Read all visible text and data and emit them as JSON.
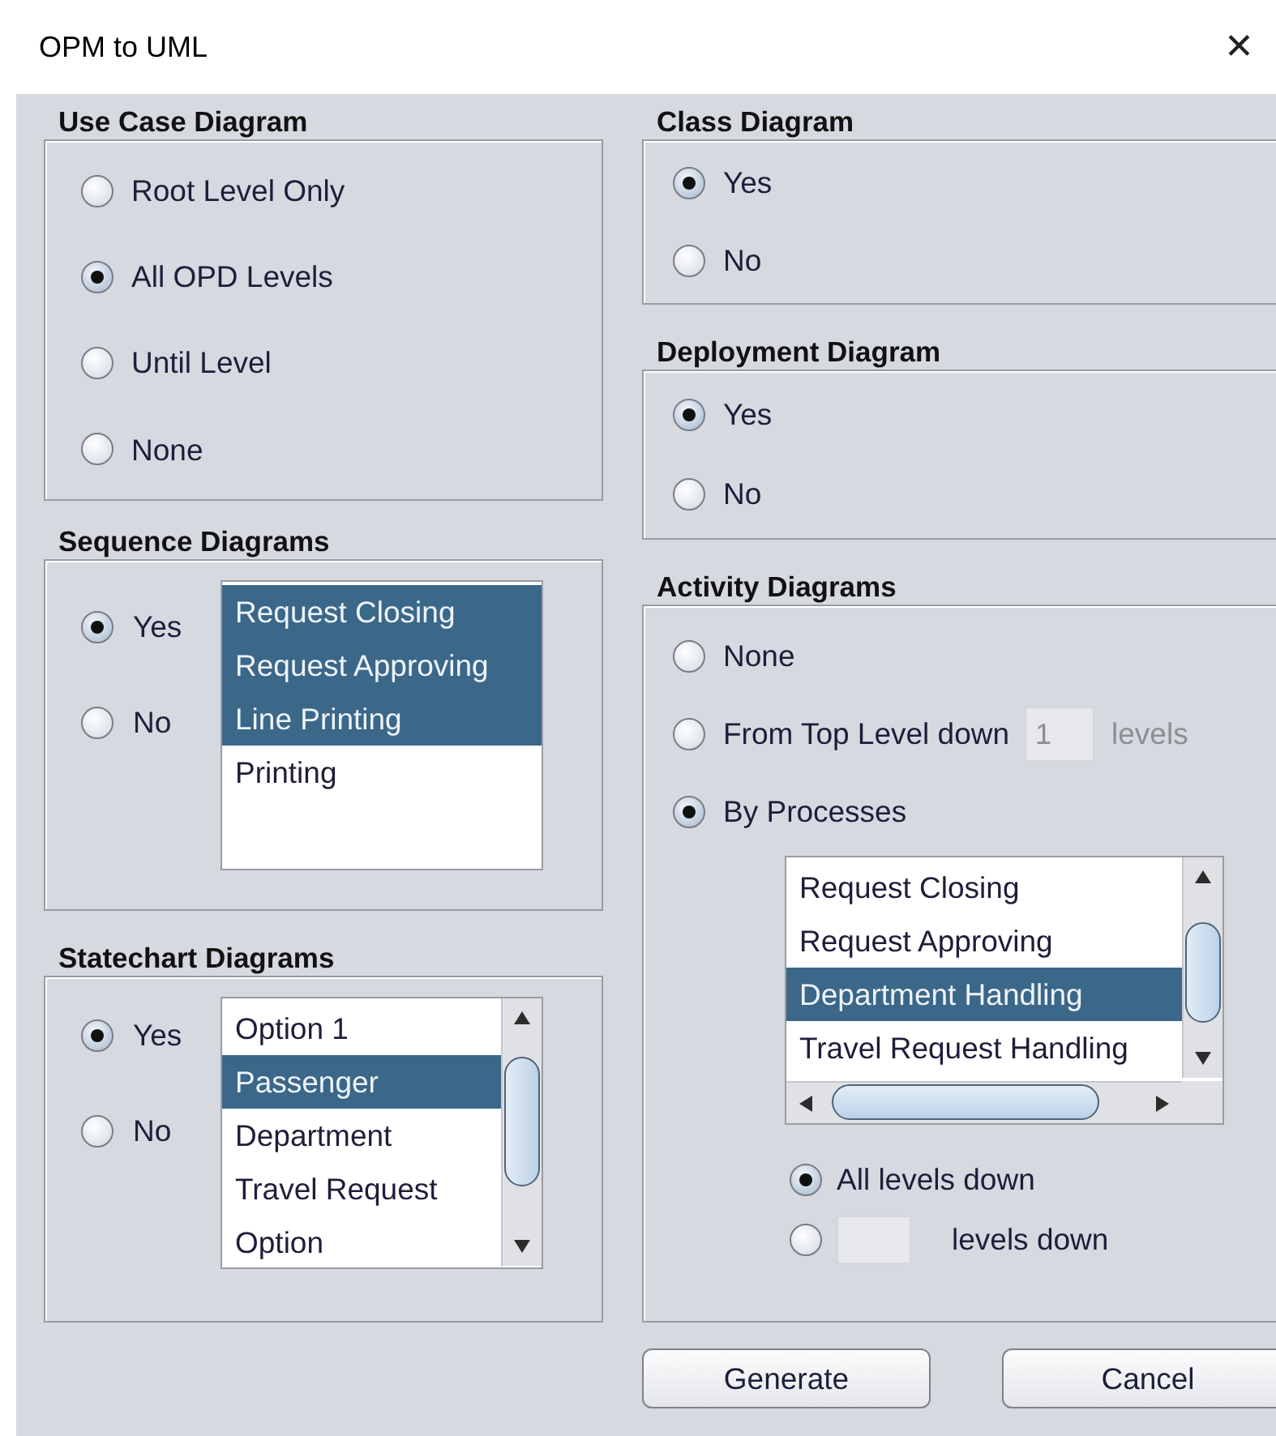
{
  "window": {
    "title": "OPM to UML",
    "close": "✕"
  },
  "use_case": {
    "title": "Use Case Diagram",
    "options": [
      {
        "label": "Root Level Only",
        "selected": false
      },
      {
        "label": "All OPD Levels",
        "selected": true
      },
      {
        "label": "Until Level",
        "selected": false
      },
      {
        "label": "None",
        "selected": false
      }
    ]
  },
  "sequence": {
    "title": "Sequence Diagrams",
    "options": [
      {
        "label": "Yes",
        "selected": true
      },
      {
        "label": "No",
        "selected": false
      }
    ],
    "items": [
      {
        "label": "Request Closing",
        "selected": true
      },
      {
        "label": "Request Approving",
        "selected": true
      },
      {
        "label": "Line Printing",
        "selected": true
      },
      {
        "label": "Printing",
        "selected": false
      }
    ]
  },
  "statechart": {
    "title": "Statechart Diagrams",
    "options": [
      {
        "label": "Yes",
        "selected": true
      },
      {
        "label": "No",
        "selected": false
      }
    ],
    "items": [
      {
        "label": "Option 1",
        "selected": false
      },
      {
        "label": "Passenger",
        "selected": true
      },
      {
        "label": "Department",
        "selected": false
      },
      {
        "label": "Travel Request",
        "selected": false
      },
      {
        "label": "Option",
        "selected": false
      }
    ]
  },
  "class_diagram": {
    "title": "Class Diagram",
    "options": [
      {
        "label": "Yes",
        "selected": true
      },
      {
        "label": "No",
        "selected": false
      }
    ]
  },
  "deployment": {
    "title": "Deployment Diagram",
    "options": [
      {
        "label": "Yes",
        "selected": true
      },
      {
        "label": "No",
        "selected": false
      }
    ]
  },
  "activity": {
    "title": "Activity Diagrams",
    "options": [
      {
        "kind": "plain",
        "label": "None",
        "selected": false
      },
      {
        "kind": "levels",
        "label": "From Top Level down",
        "value": "1",
        "suffix": "levels",
        "disabled": true,
        "selected": false
      },
      {
        "kind": "plain",
        "label": "By Processes",
        "selected": true
      }
    ],
    "items": [
      {
        "label": "Request Closing",
        "selected": false
      },
      {
        "label": "Request Approving",
        "selected": false
      },
      {
        "label": "Department Handling",
        "selected": true
      },
      {
        "label": "Travel Request Handling",
        "selected": false
      }
    ],
    "depth_options": [
      {
        "kind": "plain",
        "label": "All levels down",
        "selected": true
      },
      {
        "kind": "field",
        "suffix": "levels down",
        "selected": false
      }
    ]
  },
  "buttons": [
    "Generate",
    "Cancel"
  ]
}
